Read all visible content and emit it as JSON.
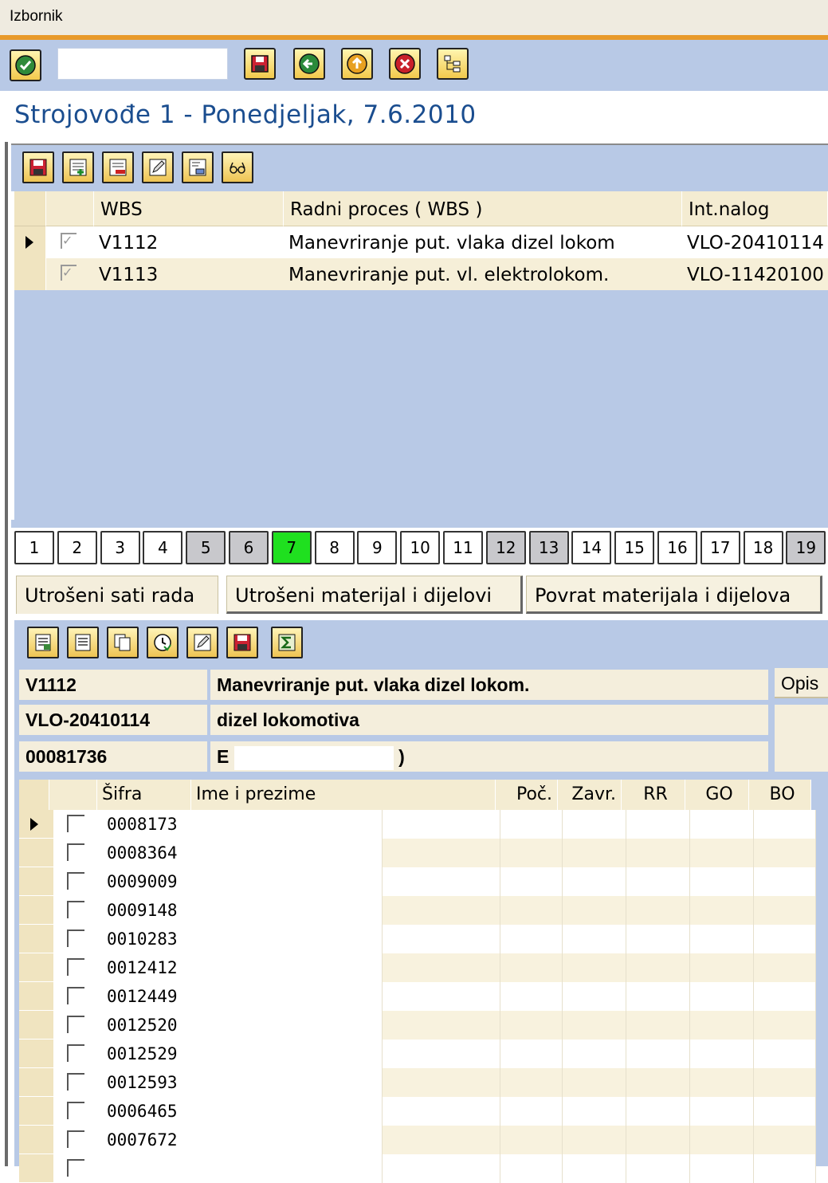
{
  "menu": {
    "label": "Izbornik"
  },
  "system_toolbar": {
    "command_field": "",
    "buttons": [
      "enter-icon",
      "save-icon",
      "back-icon",
      "exit-icon",
      "cancel-icon",
      "tree-icon"
    ]
  },
  "page_title": "Strojovođe 1 - Ponedjeljak, 7.6.2010",
  "upper_toolbar": {
    "buttons": [
      "save-icon",
      "add-row-icon",
      "delete-row-icon",
      "edit-icon",
      "export-icon",
      "glasses-icon"
    ]
  },
  "upper_table": {
    "columns": [
      "WBS",
      "Radni proces ( WBS )",
      "Int.nalog"
    ],
    "rows": [
      {
        "wbs": "V1112",
        "process": "Manevriranje put. vlaka dizel lokom",
        "order": "VLO-20410114"
      },
      {
        "wbs": "V1113",
        "process": "Manevriranje put. vl. elektrolokom.",
        "order": "VLO-11420100"
      }
    ]
  },
  "days": [
    "1",
    "2",
    "3",
    "4",
    "5",
    "6",
    "7",
    "8",
    "9",
    "10",
    "11",
    "12",
    "13",
    "14",
    "15",
    "16",
    "17",
    "18",
    "19"
  ],
  "days_weekend": [
    "5",
    "6",
    "12",
    "13",
    "19"
  ],
  "day_active": "7",
  "tabs": [
    "Utrošeni sati rada",
    "Utrošeni materijal i dijelovi",
    "Povrat materijala i dijelova"
  ],
  "lower_toolbar": {
    "buttons": [
      "details-icon",
      "document-icon",
      "copy-icon",
      "clock-icon",
      "edit-icon",
      "save-icon",
      "sum-icon"
    ]
  },
  "info": {
    "wbs": "V1112",
    "wbs_desc": "Manevriranje put. vlaka dizel lokom.",
    "order": "VLO-20410114",
    "order_desc": "dizel lokomotiva",
    "person_code": "00081736",
    "person_name_start": "E",
    "person_name_end": ")",
    "opis_label": "Opis"
  },
  "lower_table": {
    "columns": [
      "Šifra",
      "Ime i prezime",
      "Poč.",
      "Zavr.",
      "RR",
      "GO",
      "BO"
    ],
    "rows": [
      "0008173",
      "0008364",
      "0009009",
      "0009148",
      "0010283",
      "0012412",
      "0012449",
      "0012520",
      "0012529",
      "0012593",
      "0006465",
      "0007672",
      ""
    ]
  },
  "colors": {
    "toolbar_bg": "#b8c9e6",
    "title": "#1a4d8f",
    "active_day": "#1fe01f",
    "weekend_day": "#c8c8cc",
    "menu_accent": "#e89a2a"
  }
}
